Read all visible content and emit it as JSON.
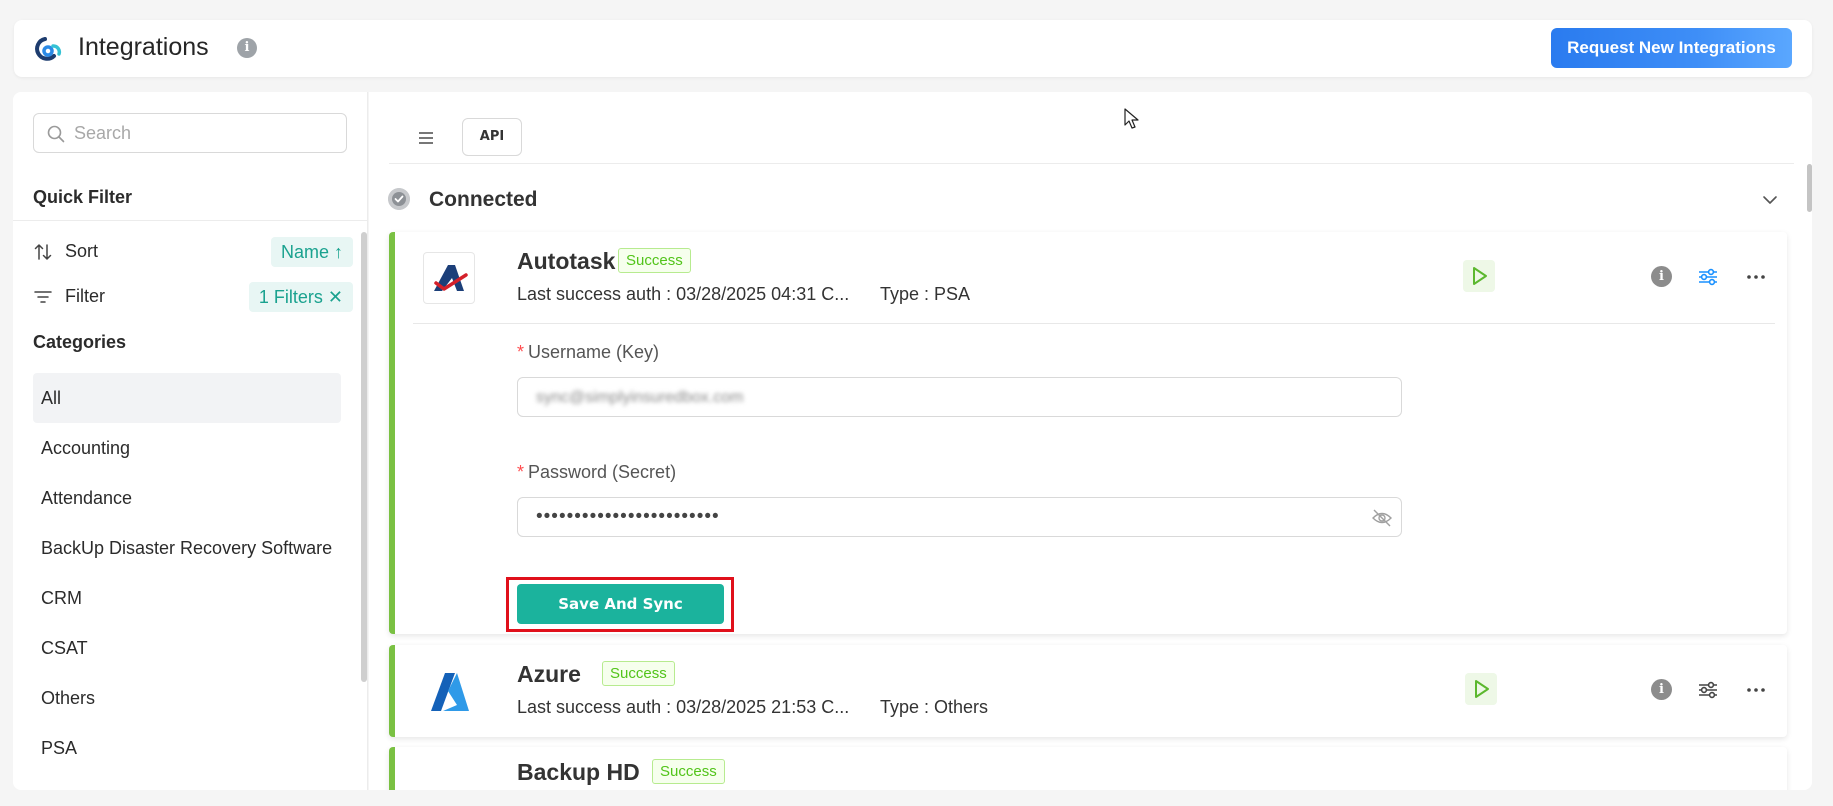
{
  "header": {
    "title": "Integrations",
    "info_glyph": "i",
    "request_button_label": "Request New Integrations"
  },
  "sidebar": {
    "search_placeholder": "Search",
    "quick_filter_title": "Quick Filter",
    "sort_label": "Sort",
    "sort_value": "Name ↑",
    "filter_label": "Filter",
    "filter_value": "1 Filters ✕",
    "categories_title": "Categories",
    "categories": [
      "All",
      "Accounting",
      "Attendance",
      "BackUp Disaster Recovery Software",
      "CRM",
      "CSAT",
      "Others",
      "PSA"
    ]
  },
  "main": {
    "api_button_label": "API",
    "section_title": "Connected",
    "cards": [
      {
        "name": "Autotask",
        "status": "Success",
        "last_auth": "Last success auth : 03/28/2025 04:31 C...",
        "type": "Type : PSA",
        "info_glyph": "i"
      },
      {
        "name": "Azure",
        "status": "Success",
        "last_auth": "Last success auth : 03/28/2025 21:53 C...",
        "type": "Type : Others",
        "info_glyph": "i"
      },
      {
        "name": "Backup HD",
        "status": "Success"
      }
    ],
    "form": {
      "required_mark": "*",
      "username_label": "Username (Key)",
      "username_value": "sync@simplyinsuredbox.com",
      "password_label": "Password (Secret)",
      "password_value": "••••••••••••••••••••••••",
      "save_button_label": "Save And Sync"
    }
  },
  "colors": {
    "accent_teal": "#1bb39d",
    "success_green": "#7ac143",
    "primary_blue": "#2a7bef",
    "highlight_red": "#e0101b"
  },
  "icons": [
    "logo-icon",
    "info-icon",
    "search-icon",
    "sort-icon",
    "filter-icon",
    "list-icon",
    "api-icon",
    "check-circle-icon",
    "chevron-down-icon",
    "autotask-logo-icon",
    "azure-logo-icon",
    "play-icon",
    "settings-sliders-icon",
    "more-icon",
    "eye-off-icon",
    "cursor-icon"
  ]
}
